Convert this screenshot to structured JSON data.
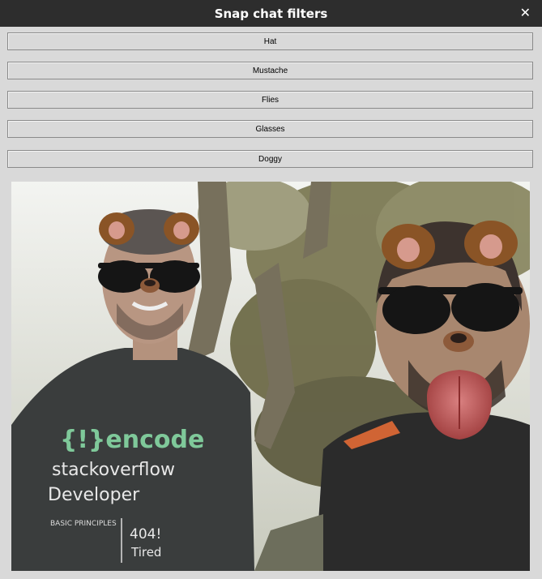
{
  "window": {
    "title": "Snap chat filters",
    "close_glyph": "✕"
  },
  "filters": [
    {
      "label": "Hat"
    },
    {
      "label": "Mustache"
    },
    {
      "label": "Flies"
    },
    {
      "label": "Glasses"
    },
    {
      "label": "Doggy"
    }
  ],
  "preview": {
    "shirt_text": {
      "logo": "{!}encode",
      "line1": "stackoverflow",
      "line2": "Developer",
      "section": "BASIC PRINCIPLES",
      "code": "404!",
      "code_sub": "Tired"
    }
  }
}
